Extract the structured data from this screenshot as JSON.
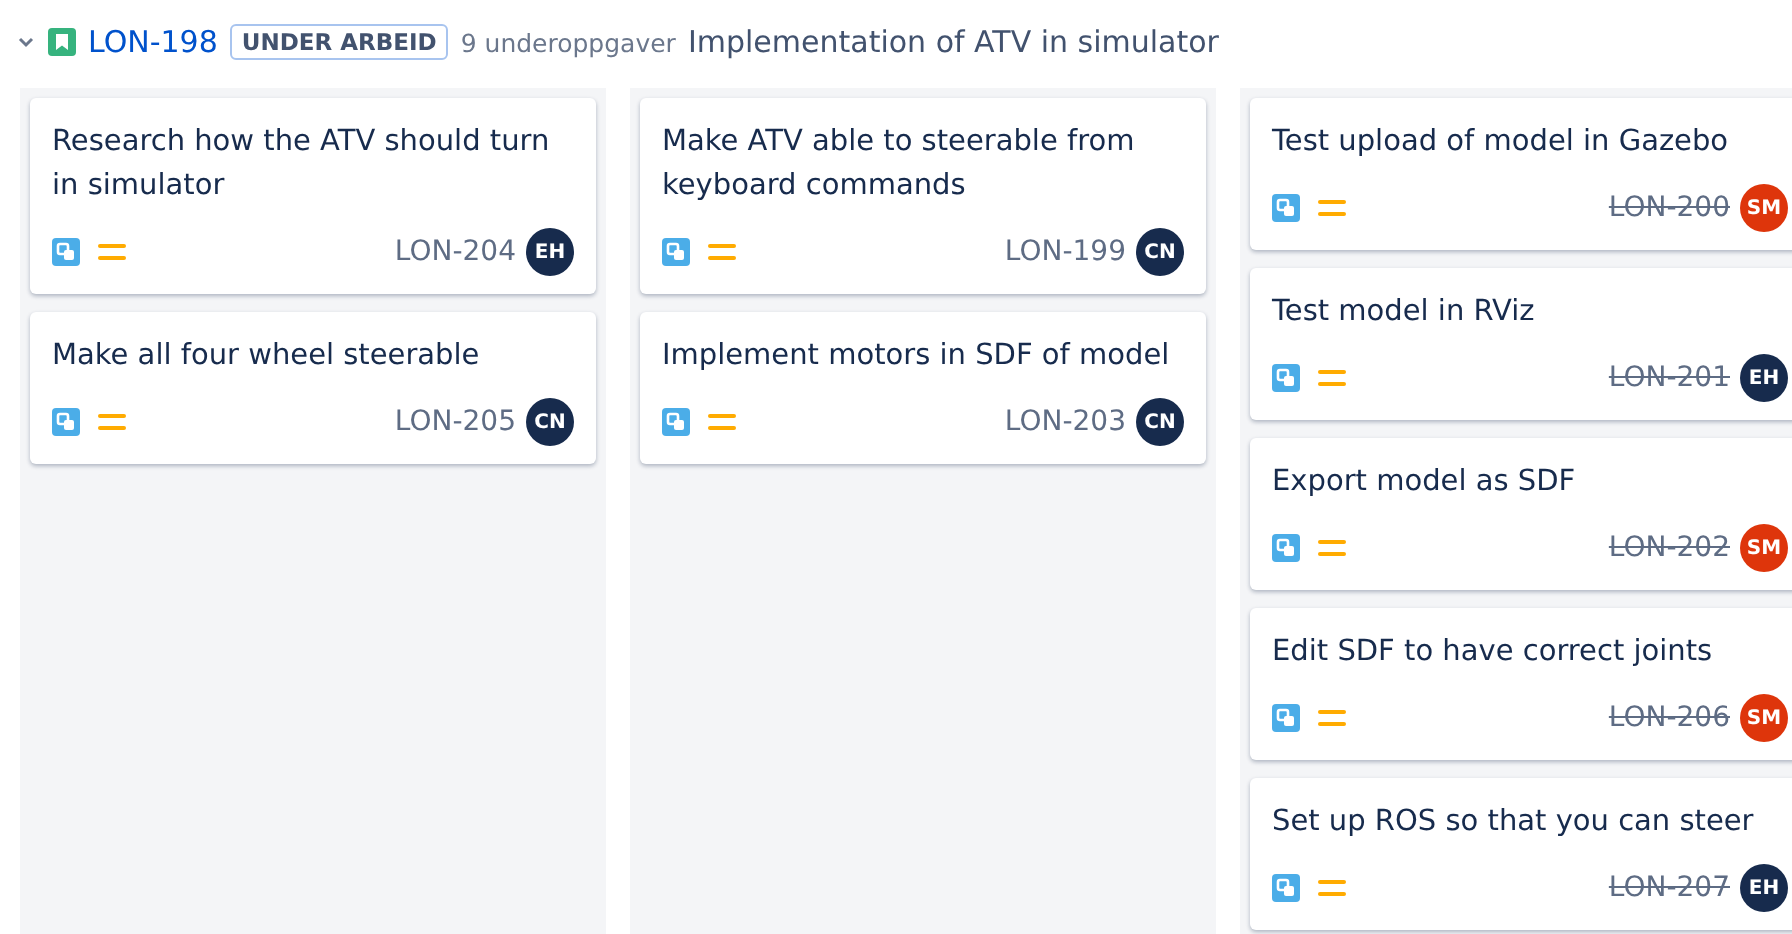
{
  "parent": {
    "expanded": true,
    "key": "LON-198",
    "status": "UNDER ARBEID",
    "subtask_count": "9 underoppgaver",
    "title": "Implementation of ATV in simulator"
  },
  "columns": [
    {
      "cards": [
        {
          "title": "Research how the ATV should turn in simulator",
          "key": "LON-204",
          "done": false,
          "assignee": {
            "initials": "EH",
            "color": "#172b4d"
          }
        },
        {
          "title": "Make all four wheel steerable",
          "key": "LON-205",
          "done": false,
          "assignee": {
            "initials": "CN",
            "color": "#172b4d"
          }
        }
      ]
    },
    {
      "cards": [
        {
          "title": "Make ATV able to steerable from keyboard commands",
          "key": "LON-199",
          "done": false,
          "assignee": {
            "initials": "CN",
            "color": "#172b4d"
          }
        },
        {
          "title": "Implement motors in SDF of model",
          "key": "LON-203",
          "done": false,
          "assignee": {
            "initials": "CN",
            "color": "#172b4d"
          }
        }
      ]
    },
    {
      "cards": [
        {
          "title": "Test upload of model in Gazebo",
          "key": "LON-200",
          "done": true,
          "assignee": {
            "initials": "SM",
            "color": "#de350b"
          }
        },
        {
          "title": "Test model in RViz",
          "key": "LON-201",
          "done": true,
          "assignee": {
            "initials": "EH",
            "color": "#172b4d"
          }
        },
        {
          "title": "Export model as SDF",
          "key": "LON-202",
          "done": true,
          "assignee": {
            "initials": "SM",
            "color": "#de350b"
          }
        },
        {
          "title": "Edit SDF to have correct joints",
          "key": "LON-206",
          "done": true,
          "assignee": {
            "initials": "SM",
            "color": "#de350b"
          }
        },
        {
          "title": "Set up ROS so that you can steer",
          "key": "LON-207",
          "done": true,
          "assignee": {
            "initials": "EH",
            "color": "#172b4d"
          }
        }
      ]
    }
  ]
}
